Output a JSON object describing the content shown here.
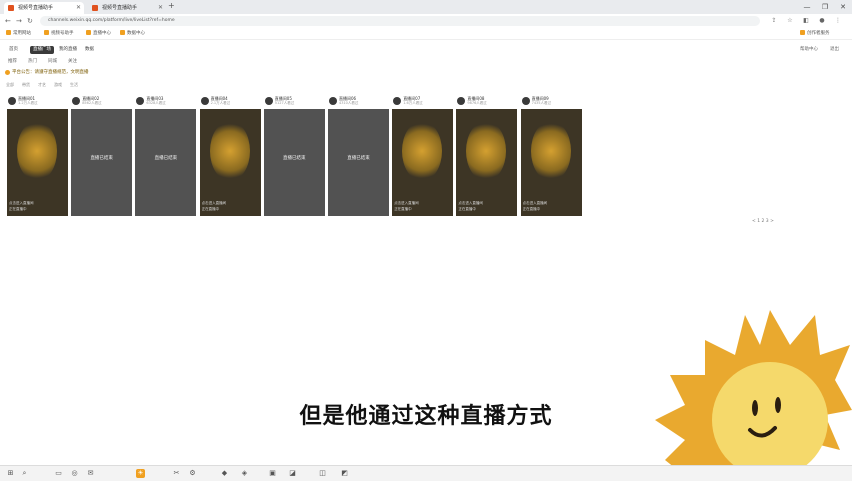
{
  "browser": {
    "tabs": [
      {
        "title": "视频号直播助手",
        "active": true
      },
      {
        "title": "视频号直播助手",
        "active": false
      }
    ],
    "url": "channels.weixin.qq.com/platform/live/liveList?ref=home",
    "window_controls": [
      "—",
      "❐",
      "✕"
    ]
  },
  "bookmarks": [
    "常用网站",
    "视频号助手",
    "直播中心",
    "数据中心",
    "创作者服务"
  ],
  "app": {
    "tabs": [
      "首页",
      "直播广场",
      "我的直播",
      "数据"
    ],
    "right_links": [
      "帮助中心",
      "退出"
    ],
    "sub_items": [
      "推荐",
      "热门",
      "同城",
      "关注"
    ],
    "notice": "平台公告：请遵守直播规范，文明直播",
    "filters": [
      "全部",
      "带货",
      "才艺",
      "游戏",
      "生活"
    ]
  },
  "streams": [
    {
      "name": "直播间01",
      "viewers": "1.2万人看过",
      "center": "",
      "foot": "正在直播中",
      "foot2": "点击进入直播间",
      "kind": "scene"
    },
    {
      "name": "直播间02",
      "viewers": "8562人看过",
      "center": "直播已结束",
      "foot": "",
      "foot2": "",
      "kind": "blank"
    },
    {
      "name": "直播间03",
      "viewers": "6328人看过",
      "center": "直播已结束",
      "foot": "",
      "foot2": "",
      "kind": "blank"
    },
    {
      "name": "直播间04",
      "viewers": "2.1万人看过",
      "center": "",
      "foot": "正在直播中",
      "foot2": "点击进入直播间",
      "kind": "scene"
    },
    {
      "name": "直播间05",
      "viewers": "5127人看过",
      "center": "直播已结束",
      "foot": "",
      "foot2": "",
      "kind": "blank"
    },
    {
      "name": "直播间06",
      "viewers": "4310人看过",
      "center": "直播已结束",
      "foot": "",
      "foot2": "",
      "kind": "blank"
    },
    {
      "name": "直播间07",
      "viewers": "1.6万人看过",
      "center": "",
      "foot": "正在直播中",
      "foot2": "点击进入直播间",
      "kind": "scene"
    },
    {
      "name": "直播间08",
      "viewers": "9876人看过",
      "center": "",
      "foot": "正在直播中",
      "foot2": "点击进入直播间",
      "kind": "scene"
    },
    {
      "name": "直播间09",
      "viewers": "7435人看过",
      "center": "",
      "foot": "正在直播中",
      "foot2": "点击进入直播间",
      "kind": "scene"
    }
  ],
  "pager": "< 1 2 3 >",
  "subtitle": "但是他通过这种直播方式",
  "colors": {
    "accent": "#f0a020",
    "card_bg": "#525252",
    "sun": "#e9a92f",
    "sun_face": "#f5d96b"
  },
  "taskbar_icons": [
    "windows-icon",
    "search-icon",
    "folder-icon",
    "browser-icon",
    "mail-icon",
    "app-icon",
    "settings-icon"
  ]
}
